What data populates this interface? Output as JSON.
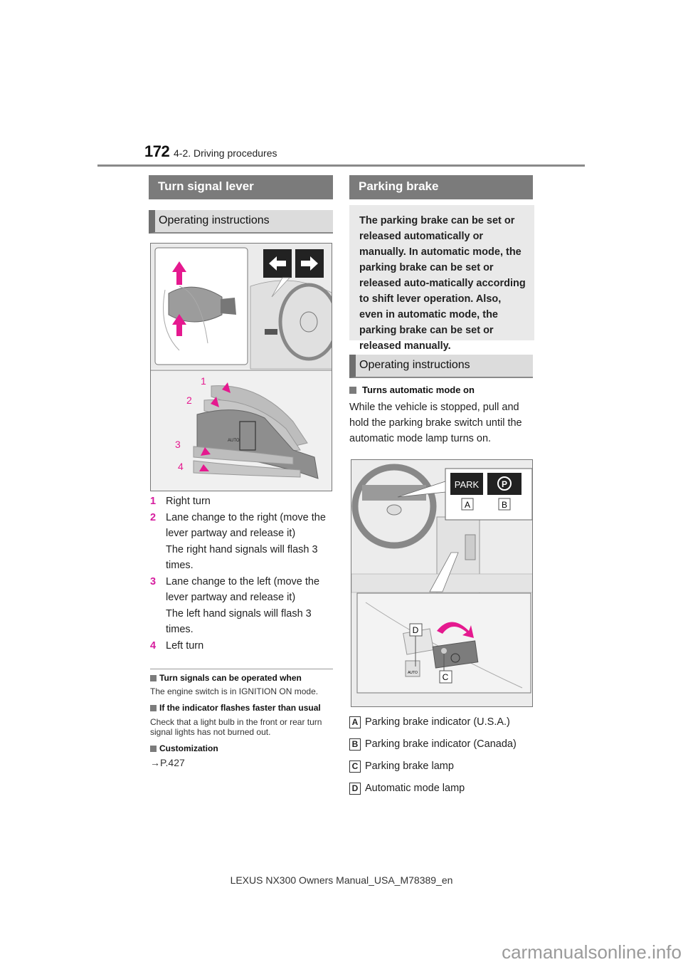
{
  "header": {
    "page_number": "172",
    "section": "4-2. Driving procedures"
  },
  "left": {
    "section_title": "Turn signal lever",
    "subsection_title": "Operating instructions",
    "figure": {
      "arrow_left_icon": "←",
      "arrow_right_icon": "→",
      "lever_labels": [
        "1",
        "2",
        "3",
        "4"
      ],
      "auto_label": "AUTO"
    },
    "items": [
      {
        "num": "1",
        "text": "Right turn"
      },
      {
        "num": "2",
        "text": "Lane change to the right (move the lever partway and release it)",
        "sub": "The right hand signals will flash 3 times."
      },
      {
        "num": "3",
        "text": "Lane change to the left (move the lever partway and release it)",
        "sub": "The left hand signals will flash 3 times."
      },
      {
        "num": "4",
        "text": "Left turn"
      }
    ],
    "notes": [
      {
        "title": "Turn signals can be operated when",
        "body": "The engine switch is in IGNITION ON mode."
      },
      {
        "title": "If the indicator flashes faster than usual",
        "body": "Check that a light bulb in the front or rear turn signal lights has not burned out."
      },
      {
        "title": "Customization",
        "body": "→P.427"
      }
    ]
  },
  "right": {
    "section_title": "Parking brake",
    "intro": "The parking brake can be set or released automatically or manually. In automatic mode, the parking brake can be set or released auto-matically according to shift lever operation. Also, even in automatic mode, the parking brake can be set or released manually.",
    "subsection_title": "Operating instructions",
    "bullet_title": "Turns automatic mode on",
    "bullet_body": "While the vehicle is stopped, pull and hold the parking brake switch until the automatic mode lamp turns on.",
    "figure": {
      "park_label": "PARK",
      "p_symbol": "(P)",
      "callouts": [
        "A",
        "B",
        "C",
        "D"
      ],
      "auto_label": "AUTO"
    },
    "legend": [
      {
        "key": "A",
        "text": "Parking brake indicator (U.S.A.)"
      },
      {
        "key": "B",
        "text": "Parking brake indicator (Canada)"
      },
      {
        "key": "C",
        "text": "Parking brake lamp"
      },
      {
        "key": "D",
        "text": "Automatic mode lamp"
      }
    ]
  },
  "footer": "LEXUS NX300 Owners Manual_USA_M78389_en",
  "watermark": "carmanualsonline.info",
  "colors": {
    "accent_magenta": "#d61c9e",
    "section_header": "#7b7b7b",
    "subsection_bg": "#dcdcdc"
  }
}
